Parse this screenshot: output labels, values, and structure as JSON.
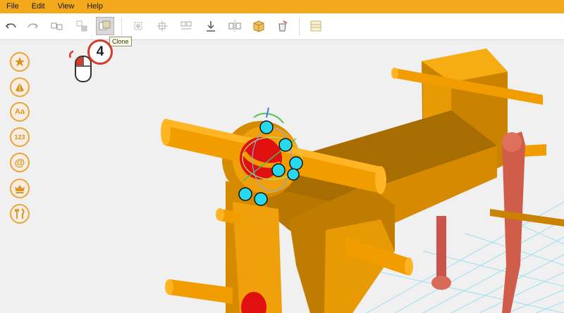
{
  "menu": [
    "File",
    "Edit",
    "View",
    "Help"
  ],
  "toolbar": {
    "buttons": [
      "undo-icon",
      "redo-icon",
      "group-icon",
      "ungroup-icon",
      "clone-icon",
      "align-icon",
      "scatter-icon",
      "split-icon",
      "drop-to-floor-icon",
      "mirror-icon",
      "box-solid-icon",
      "paint-bucket-icon",
      "grid-icon"
    ],
    "active": "clone-icon",
    "tooltip": "Clone"
  },
  "sidebar": {
    "items": [
      {
        "name": "favorites-star-icon",
        "label": ""
      },
      {
        "name": "shapes-icon",
        "label": ""
      },
      {
        "name": "text-icon",
        "label": "Aa"
      },
      {
        "name": "numbers-icon",
        "label": "123"
      },
      {
        "name": "symbols-icon",
        "label": "@"
      },
      {
        "name": "crown-icon",
        "label": ""
      },
      {
        "name": "tools-icon",
        "label": ""
      }
    ]
  },
  "callout": {
    "step": "4",
    "mouse": "left-click-icon"
  },
  "colors": {
    "menubar": "#f4a81b",
    "model": "#f19d00",
    "accent_red": "#d63a2a",
    "gizmo_handles": "#27d8ef",
    "grid": "#9ddff0"
  }
}
